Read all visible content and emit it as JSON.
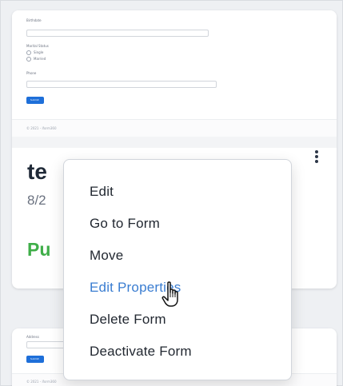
{
  "form_preview": {
    "field_labels": [
      "Birthdate",
      "Marital Status",
      "Phone"
    ],
    "radio_options": [
      "Single",
      "Married"
    ],
    "submit_label": "Submit",
    "footer_text": "© 2021 - iform360"
  },
  "form_preview_2": {
    "field_labels": [
      "Address"
    ],
    "submit_label": "Submit",
    "footer_text": "© 2021 - iform360"
  },
  "card": {
    "title": "te",
    "date": "8/2",
    "status": "Pu",
    "status_color": "#3fae49"
  },
  "menu": {
    "items": [
      "Edit",
      "Go to Form",
      "Move",
      "Edit Properties",
      "Delete Form",
      "Deactivate Form"
    ],
    "active_index": 3,
    "active_color": "#3a7dd1"
  },
  "icons": {
    "kebab": "more-vertical-icon",
    "cursor": "hand-pointer-icon"
  }
}
